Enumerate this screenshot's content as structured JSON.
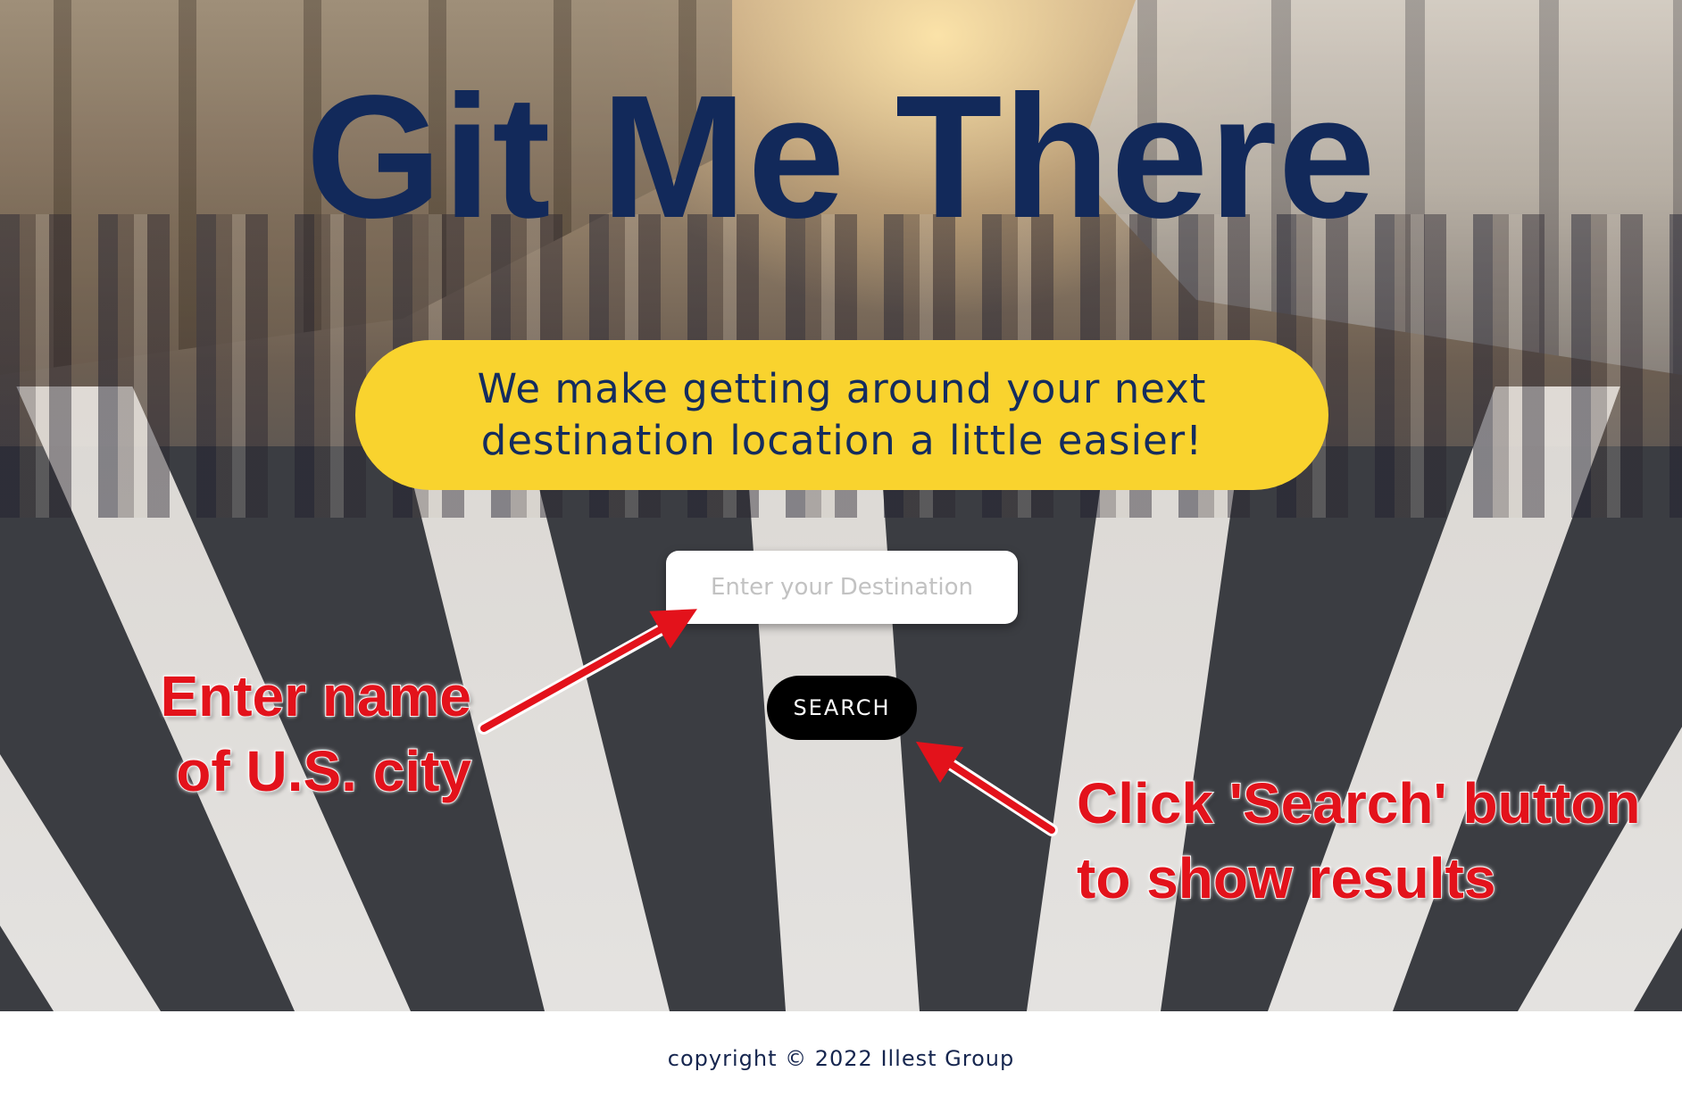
{
  "hero": {
    "title": "Git Me There",
    "tagline": "We make getting around your next destination location a little easier!"
  },
  "search": {
    "placeholder": "Enter your Destination",
    "value": "",
    "button_label": "SEARCH"
  },
  "annotations": {
    "input_hint_line1": "Enter name",
    "input_hint_line2": "of U.S. city",
    "button_hint_line1": "Click 'Search' button",
    "button_hint_line2": "to show results"
  },
  "footer": {
    "copyright": "copyright ©  2022 Illest Group"
  },
  "colors": {
    "title": "#12295a",
    "tagline_bg": "#f9d32e",
    "tagline_text": "#142c5e",
    "button_bg": "#000000",
    "annotation": "#e3121b"
  }
}
